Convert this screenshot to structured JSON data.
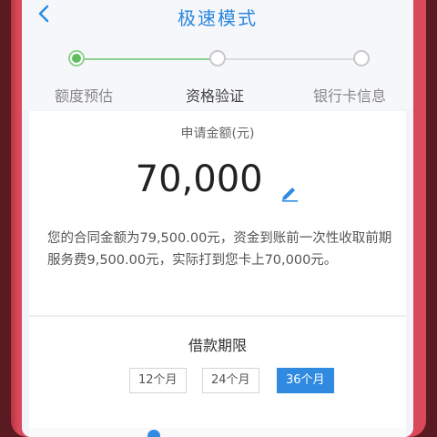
{
  "header": {
    "title": "极速模式",
    "back_icon": "chevron-left-icon"
  },
  "steps": [
    {
      "label": "额度预估",
      "state": "done"
    },
    {
      "label": "资格验证",
      "state": "current"
    },
    {
      "label": "银行卡信息",
      "state": "pending"
    }
  ],
  "amount": {
    "caption": "申请金额(元)",
    "value": "70,000",
    "edit_icon": "pencil-icon"
  },
  "note": "您的合同金额为79,500.00元，资金到账前一次性收取前期服务费9,500.00元，实际打到您卡上70,000元。",
  "loan_term": {
    "title": "借款期限",
    "options": [
      "12个月",
      "24个月",
      "36个月"
    ],
    "selected": "36个月"
  },
  "colors": {
    "accent": "#2f8ae0",
    "step_done": "#5fbf5f",
    "frame": "#d9495a"
  }
}
